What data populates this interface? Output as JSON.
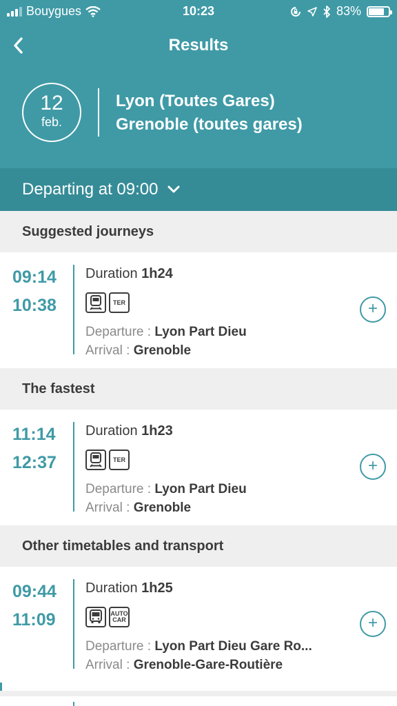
{
  "status": {
    "carrier": "Bouygues",
    "time": "10:23",
    "battery": "83%"
  },
  "nav": {
    "title": "Results",
    "back_icon": "chevron-left-icon"
  },
  "search": {
    "day": "12",
    "month": "feb.",
    "origin": "Lyon (Toutes Gares)",
    "destination": "Grenoble (toutes gares)",
    "departing": "Departing at 09:00"
  },
  "sections": [
    {
      "title": "Suggested journeys",
      "journey": {
        "depart": "09:14",
        "arrive": "10:38",
        "duration_label": "Duration",
        "duration": "1h24",
        "modes": [
          "train-icon",
          "TER"
        ],
        "departure_label": "Departure :",
        "departure": "Lyon Part Dieu",
        "arrival_label": "Arrival :",
        "arrival": "Grenoble"
      }
    },
    {
      "title": "The fastest",
      "journey": {
        "depart": "11:14",
        "arrive": "12:37",
        "duration_label": "Duration",
        "duration": "1h23",
        "modes": [
          "train-icon",
          "TER"
        ],
        "departure_label": "Departure :",
        "departure": "Lyon Part Dieu",
        "arrival_label": "Arrival :",
        "arrival": "Grenoble"
      }
    },
    {
      "title": "Other timetables and transport",
      "journey": {
        "depart": "09:44",
        "arrive": "11:09",
        "duration_label": "Duration",
        "duration": "1h25",
        "modes": [
          "bus-icon",
          "AUTO CAR"
        ],
        "departure_label": "Departure :",
        "departure": "Lyon Part Dieu Gare Ro...",
        "arrival_label": "Arrival :",
        "arrival": "Grenoble-Gare-Routière"
      }
    }
  ],
  "colors": {
    "header": "#3f9aa6",
    "departing_bar": "#358c97",
    "accent": "#3f9aa6",
    "section_bg": "#efefef"
  }
}
